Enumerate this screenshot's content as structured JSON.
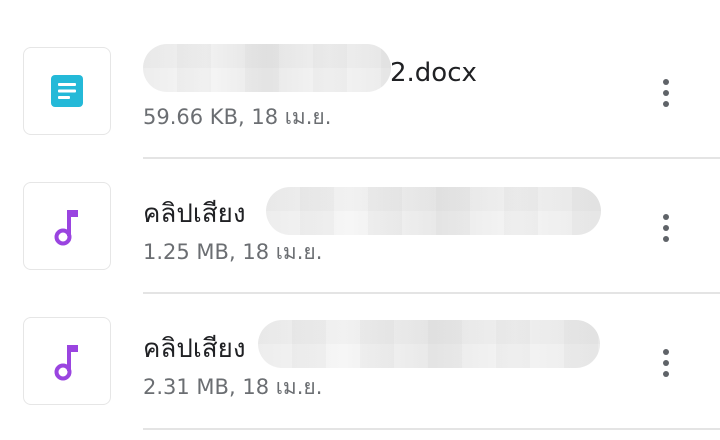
{
  "files": [
    {
      "title_suffix": "2.docx",
      "size": "59.66 KB",
      "date": "18 เม.ย.",
      "icon": "document-icon",
      "icon_color": "#24b9d8"
    },
    {
      "title_prefix": "คลิปเสียง",
      "size": "1.25 MB",
      "date": "18 เม.ย.",
      "icon": "music-note-icon",
      "icon_color": "#9a44e0"
    },
    {
      "title_prefix": "คลิปเสียง",
      "size": "2.31 MB",
      "date": "18 เม.ย.",
      "icon": "music-note-icon",
      "icon_color": "#9a44e0"
    }
  ],
  "separator": ", "
}
